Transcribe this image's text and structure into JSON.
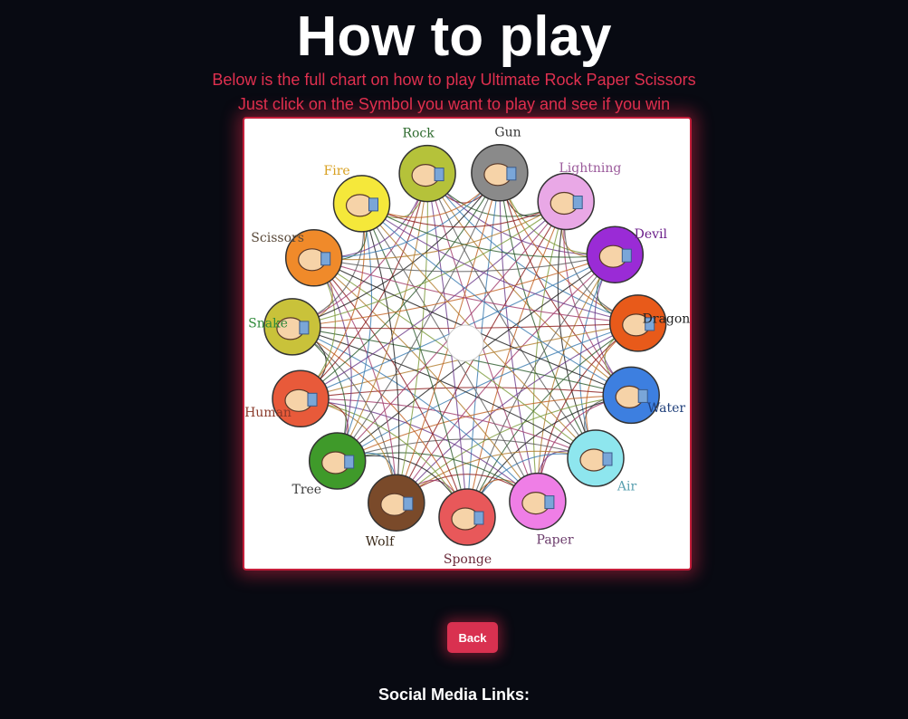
{
  "page": {
    "title": "How to play",
    "subtitle_line1": "Below is the full chart on how to play Ultimate Rock Paper Scissors",
    "subtitle_line2": "Just click on the Symbol you want to play and see if you win"
  },
  "chart": {
    "symbols": [
      {
        "name": "Rock",
        "color": "#b5c23a",
        "label_color": "#2f6b2f"
      },
      {
        "name": "Gun",
        "color": "#8a8a8a",
        "label_color": "#333333"
      },
      {
        "name": "Lightning",
        "color": "#e9a8e6",
        "label_color": "#9b5a9b"
      },
      {
        "name": "Devil",
        "color": "#9a2bd6",
        "label_color": "#6b1f8a"
      },
      {
        "name": "Dragon",
        "color": "#e85a1a",
        "label_color": "#222222"
      },
      {
        "name": "Water",
        "color": "#3d7fe0",
        "label_color": "#1f3f7a"
      },
      {
        "name": "Air",
        "color": "#8ee6ee",
        "label_color": "#5aa0b0"
      },
      {
        "name": "Paper",
        "color": "#ef7ee6",
        "label_color": "#6a3a6a"
      },
      {
        "name": "Sponge",
        "color": "#e8585a",
        "label_color": "#6a2a3a"
      },
      {
        "name": "Wolf",
        "color": "#7a4a2a",
        "label_color": "#3a2a1a"
      },
      {
        "name": "Tree",
        "color": "#3f9a2a",
        "label_color": "#3a3a3a"
      },
      {
        "name": "Human",
        "color": "#e85a3a",
        "label_color": "#8a3a2a"
      },
      {
        "name": "Snake",
        "color": "#c9c23a",
        "label_color": "#2f8a3a"
      },
      {
        "name": "Scissors",
        "color": "#f08a2a",
        "label_color": "#5a4a3a"
      },
      {
        "name": "Fire",
        "color": "#f5e83a",
        "label_color": "#d8a020"
      }
    ],
    "line_colors": [
      "#8b1a1a",
      "#2a5a2a",
      "#6a3a8a",
      "#3a7ab0",
      "#b07a2a",
      "#5a5a5a",
      "#a03a6a",
      "#1a1a1a",
      "#7a9a3a",
      "#c06020"
    ]
  },
  "buttons": {
    "back_label": "Back"
  },
  "footer": {
    "social_heading": "Social Media Links:"
  }
}
